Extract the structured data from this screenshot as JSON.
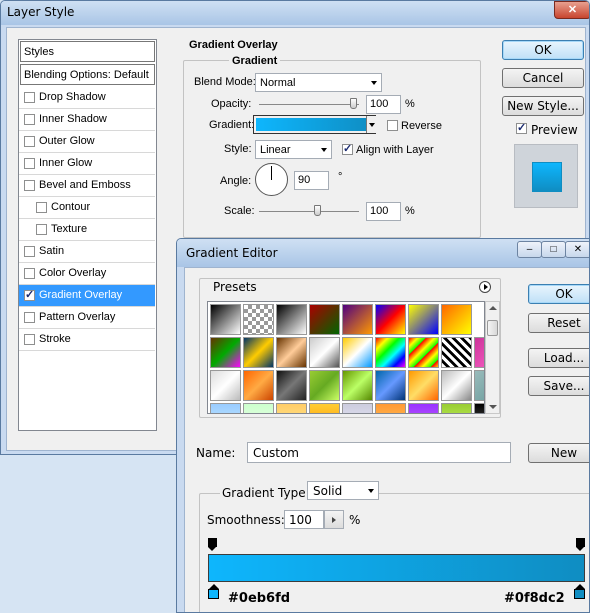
{
  "layer_style": {
    "title": "Layer Style",
    "styles_header": "Styles",
    "blending_options": "Blending Options: Default",
    "effects": [
      {
        "label": "Drop Shadow",
        "checked": false
      },
      {
        "label": "Inner Shadow",
        "checked": false
      },
      {
        "label": "Outer Glow",
        "checked": false
      },
      {
        "label": "Inner Glow",
        "checked": false
      },
      {
        "label": "Bevel and Emboss",
        "checked": false
      },
      {
        "label": "Contour",
        "checked": false
      },
      {
        "label": "Texture",
        "checked": false
      },
      {
        "label": "Satin",
        "checked": false
      },
      {
        "label": "Color Overlay",
        "checked": false
      },
      {
        "label": "Gradient Overlay",
        "checked": true
      },
      {
        "label": "Pattern Overlay",
        "checked": false
      },
      {
        "label": "Stroke",
        "checked": false
      }
    ],
    "section_title": "Gradient Overlay",
    "group_title": "Gradient",
    "blend_mode_label": "Blend Mode:",
    "blend_mode_value": "Normal",
    "opacity_label": "Opacity:",
    "opacity_value": "100",
    "opacity_unit": "%",
    "opacity_level": 1.0,
    "gradient_label": "Gradient:",
    "reverse_label": "Reverse",
    "reverse_checked": false,
    "style_label": "Style:",
    "style_value": "Linear",
    "align_label": "Align with Layer",
    "align_checked": true,
    "angle_label": "Angle:",
    "angle_value": "90",
    "angle_unit": "°",
    "scale_label": "Scale:",
    "scale_value": "100",
    "scale_unit": "%",
    "scale_level": 0.4,
    "ok_label": "OK",
    "cancel_label": "Cancel",
    "new_style_label": "New Style...",
    "preview_label": "Preview",
    "preview_checked": true,
    "close_glyph": "✕"
  },
  "gradient_editor": {
    "title": "Gradient Editor",
    "presets_label": "Presets",
    "ok_label": "OK",
    "reset_label": "Reset",
    "load_label": "Load...",
    "save_label": "Save...",
    "name_label": "Name:",
    "name_value": "Custom",
    "new_label": "New",
    "gradient_type_label": "Gradient Type:",
    "gradient_type_value": "Solid",
    "smoothness_label": "Smoothness:",
    "smoothness_value": "100",
    "smoothness_unit": "%",
    "color_start": "#0eb6fd",
    "color_end": "#0f8dc2",
    "min_glyph": "–",
    "max_glyph": "□",
    "close_glyph": "✕"
  },
  "colors": {
    "gradient_start": "#0eb6fd",
    "gradient_end": "#0f8dc2",
    "selection": "#3399ff"
  }
}
